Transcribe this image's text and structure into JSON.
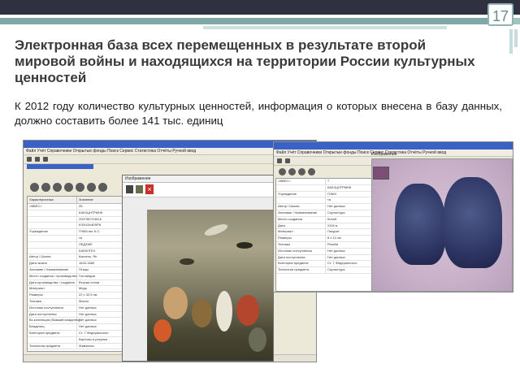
{
  "slide": {
    "page_number": "17",
    "title": "Электронная база всех перемещенных в результате второй мировой войны и находящихся на территории России культурных ценностей",
    "subtitle": "К 2012 году количество культурных ценностей, информация о которых внесена в базу данных, должно составить более 141 тыс. единиц"
  },
  "window1": {
    "menu": "Файл  Учёт  Справочники  Открытые фонды  Поиск  Сервис  Статистика  Отчёты  Ручной ввод",
    "grid_header": [
      "Характеристика",
      "Значение"
    ],
    "rows": [
      [
        "<ВВЕС>",
        "05"
      ],
      [
        "",
        "КАЕ4ЦНТРМНК"
      ],
      [
        "",
        "2007/50724516"
      ],
      [
        "",
        "КЭ3/43ч4ЕКР6"
      ],
      [
        "Учреждение",
        "ГНКМ им. К.С."
      ],
      [
        "",
        "та"
      ],
      [
        "",
        "ЛЕДЗЖЕ"
      ],
      [
        "",
        "КАЕКЛТЕХ"
      ],
      [
        "Автор / Школа",
        "Кассель, Ян"
      ],
      [
        "Даты жизни",
        "1643-1689"
      ],
      [
        "Заглавие / Наименование",
        "Птицы"
      ],
      [
        "Место создания / производства",
        "Голландия"
      ],
      [
        "Дата производства / создания",
        "Вторая полов"
      ],
      [
        "Материал",
        "Медь"
      ],
      [
        "Размеры",
        "22 х 32,5 см"
      ],
      [
        "Техника",
        "Масло"
      ],
      [
        "Источник поступления",
        "Нет данных"
      ],
      [
        "Дата поступления",
        "Нет данных"
      ],
      [
        "Вх.коллекция (бывший владелец)",
        "Нет данных"
      ],
      [
        "Владелец",
        "Нет данных"
      ],
      [
        "Категория предмета",
        "Ст. 7 Федерального"
      ],
      [
        "",
        "Картины и рисунки"
      ],
      [
        "Типология предмета",
        "Живопись"
      ]
    ]
  },
  "popup": {
    "title": "Изображение"
  },
  "window2": {
    "image_title": "Изображение",
    "rows": [
      [
        "<ВВЕС>",
        "7"
      ],
      [
        "",
        "КАЕ4ЦНТРМНК"
      ],
      [
        "Учреждение",
        "ГНКМ"
      ],
      [
        "",
        "та"
      ],
      [
        "Автор / Школа",
        "Нет данных"
      ],
      [
        "Заглавие / Наименование",
        "Скульптура"
      ],
      [
        "Место создания",
        "Китай"
      ],
      [
        "Дата",
        "XVIII в."
      ],
      [
        "Материал",
        "Лазурит"
      ],
      [
        "Размеры",
        "8 х 12 см"
      ],
      [
        "Техника",
        "Резьба"
      ],
      [
        "Источник поступления",
        "Нет данных"
      ],
      [
        "Дата поступления",
        "Нет данных"
      ],
      [
        "Категория предмета",
        "Ст. 7 Федерального"
      ],
      [
        "Типология предмета",
        "Скульптура"
      ]
    ]
  }
}
